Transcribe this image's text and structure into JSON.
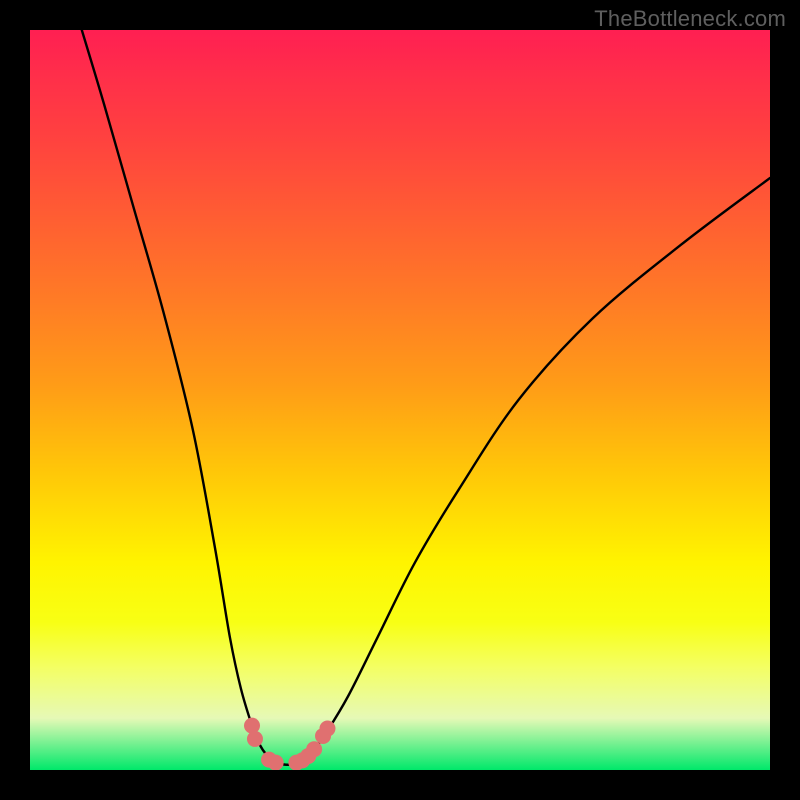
{
  "watermark": "TheBottleneck.com",
  "chart_data": {
    "type": "line",
    "title": "",
    "xlabel": "",
    "ylabel": "",
    "xlim": [
      0,
      100
    ],
    "ylim": [
      0,
      100
    ],
    "series": [
      {
        "name": "left-branch",
        "x": [
          7,
          10,
          14,
          18,
          22,
          25,
          27,
          28.5,
          30,
          31,
          32,
          33
        ],
        "y": [
          100,
          90,
          76,
          62,
          46,
          30,
          18,
          11,
          6,
          3.5,
          2,
          1.2
        ]
      },
      {
        "name": "right-branch",
        "x": [
          37,
          38,
          40,
          43,
          47,
          52,
          58,
          66,
          76,
          88,
          100
        ],
        "y": [
          1.2,
          2.2,
          5,
          10,
          18,
          28,
          38,
          50,
          61,
          71,
          80
        ]
      },
      {
        "name": "valley-floor",
        "x": [
          33,
          34,
          35,
          36,
          37
        ],
        "y": [
          1.2,
          0.8,
          0.7,
          0.8,
          1.2
        ]
      }
    ],
    "markers": [
      {
        "name": "left-dot-upper-1",
        "x": 30.0,
        "y": 6.0
      },
      {
        "name": "left-dot-upper-2",
        "x": 30.4,
        "y": 4.2
      },
      {
        "name": "left-dot-lower-1",
        "x": 32.3,
        "y": 1.4
      },
      {
        "name": "left-dot-lower-2",
        "x": 33.2,
        "y": 1.0
      },
      {
        "name": "right-dot-lower-1",
        "x": 36.0,
        "y": 1.0
      },
      {
        "name": "right-dot-lower-2",
        "x": 36.8,
        "y": 1.3
      },
      {
        "name": "right-dot-lower-3",
        "x": 37.6,
        "y": 1.9
      },
      {
        "name": "right-dot-lower-4",
        "x": 38.4,
        "y": 2.8
      },
      {
        "name": "right-dot-upper-1",
        "x": 39.6,
        "y": 4.6
      },
      {
        "name": "right-dot-upper-2",
        "x": 40.2,
        "y": 5.6
      }
    ],
    "marker_color": "#e07070",
    "curve_color": "#000000",
    "curve_width": 2.4
  }
}
